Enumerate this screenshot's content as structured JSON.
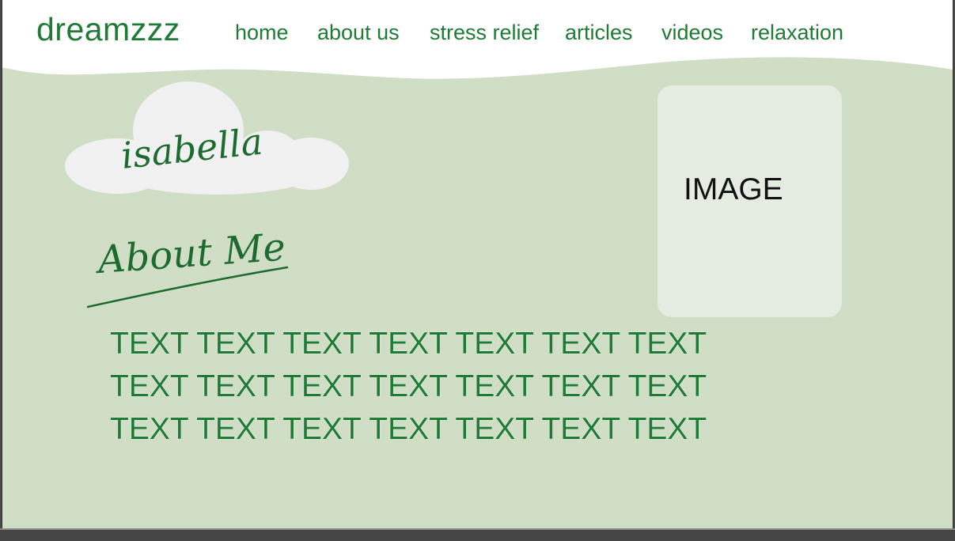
{
  "header": {
    "logo": "dreamzzz",
    "nav": [
      {
        "label": "home"
      },
      {
        "label": "about us"
      },
      {
        "label": "stress relief"
      },
      {
        "label": "articles"
      },
      {
        "label": "videos"
      },
      {
        "label": "relaxation"
      }
    ]
  },
  "hero": {
    "name_script": "isabella",
    "heading_script": "About Me"
  },
  "content": {
    "lines": [
      "TEXT TEXT TEXT TEXT TEXT TEXT TEXT",
      "TEXT TEXT TEXT TEXT TEXT TEXT TEXT",
      "TEXT TEXT TEXT TEXT TEXT TEXT TEXT"
    ]
  },
  "image_placeholder": {
    "label": "IMAGE"
  },
  "colors": {
    "background": "#cfdec5",
    "header": "#ffffff",
    "accent_green": "#1e7a34",
    "cloud": "#f2f2f2",
    "image_box": "#e5ece1"
  }
}
